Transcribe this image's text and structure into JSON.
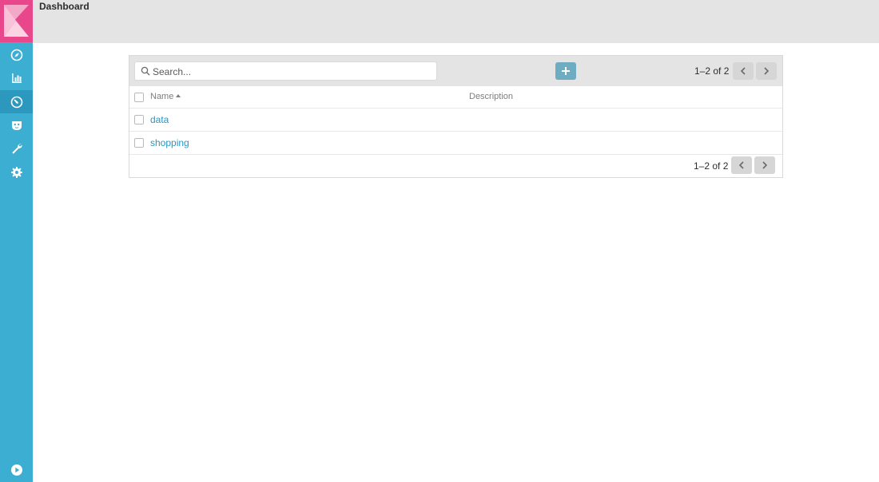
{
  "header": {
    "title": "Dashboard"
  },
  "sidebar": {
    "items": [
      {
        "name": "discover",
        "icon": "compass-icon",
        "active": false
      },
      {
        "name": "visualize",
        "icon": "bar-chart-icon",
        "active": false
      },
      {
        "name": "dashboard",
        "icon": "dashboard-gauge-icon",
        "active": true
      },
      {
        "name": "timelion",
        "icon": "shield-mask-icon",
        "active": false
      },
      {
        "name": "dev-tools",
        "icon": "wrench-icon",
        "active": false
      },
      {
        "name": "management",
        "icon": "gear-icon",
        "active": false
      }
    ],
    "bottom_icon": "play-circle-icon"
  },
  "listing": {
    "search_placeholder": "Search...",
    "add_icon": "plus-icon",
    "pager_top": "1–2 of 2",
    "pager_bottom": "1–2 of 2",
    "columns": {
      "name": "Name",
      "description": "Description"
    },
    "rows": [
      {
        "name": "data",
        "description": ""
      },
      {
        "name": "shopping",
        "description": ""
      }
    ]
  },
  "colors": {
    "sidebar": "#3caed2",
    "logo": "#e8478b",
    "link": "#2897c4",
    "add_button": "#6eadc1"
  }
}
